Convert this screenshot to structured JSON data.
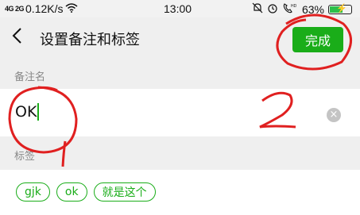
{
  "status_bar": {
    "signal": "4G 2G",
    "speed": "0.12K/s",
    "time": "13:00",
    "battery": "63%",
    "battery_level": 0.63,
    "icons": [
      "signal-icon",
      "wifi-icon",
      "mute-icon",
      "alarm-icon",
      "hd-call-icon",
      "battery-icon"
    ]
  },
  "header": {
    "back_icon": "chevron-left-icon",
    "title": "设置备注和标签",
    "done_label": "完成"
  },
  "remark": {
    "label": "备注名",
    "value": "OK"
  },
  "tags_section": {
    "label": "标签",
    "tags": [
      "gjk",
      "ok",
      "就是这个"
    ]
  },
  "colors": {
    "accent": "#1aad19",
    "annotation": "#e02020",
    "band": "#efefef"
  }
}
